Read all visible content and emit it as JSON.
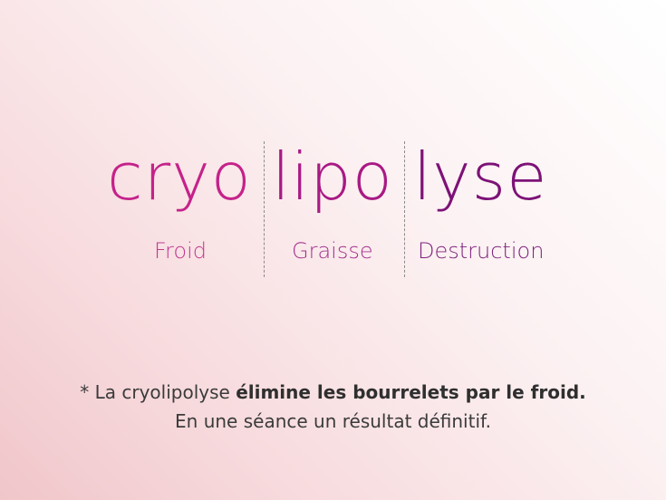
{
  "headline": {
    "parts": [
      "cryo",
      "lipo",
      "lyse"
    ],
    "meanings": [
      "Froid",
      "Graisse",
      "Destruction"
    ]
  },
  "tagline": {
    "line1_prefix": "* La cryolipolyse ",
    "line1_bold": "élimine les bourrelets par le froid.",
    "line2": "En une séance un résultat définitif."
  },
  "colors": {
    "cryo": "#c5228a",
    "lipo": "#a81a84",
    "lyse": "#7d1277",
    "text": "#3b3b3b"
  }
}
